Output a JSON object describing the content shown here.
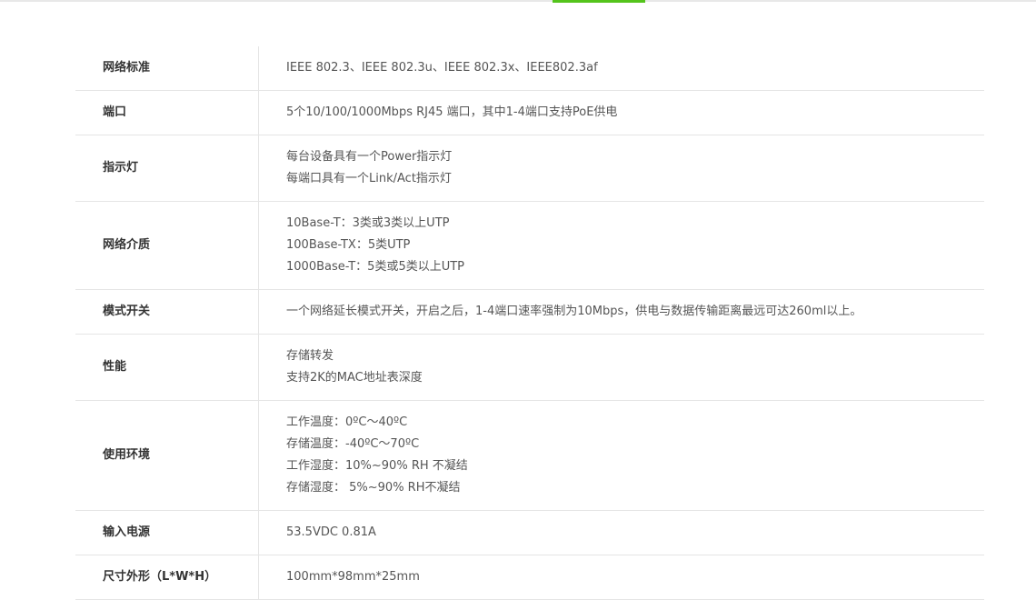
{
  "specs": [
    {
      "label": "网络标准",
      "lines": [
        "IEEE 802.3、IEEE 802.3u、IEEE 802.3x、IEEE802.3af"
      ]
    },
    {
      "label": "端口",
      "lines": [
        "5个10/100/1000Mbps RJ45 端口，其中1-4端口支持PoE供电"
      ]
    },
    {
      "label": "指示灯",
      "lines": [
        "每台设备具有一个Power指示灯",
        "每端口具有一个Link/Act指示灯"
      ]
    },
    {
      "label": "网络介质",
      "lines": [
        "10Base-T：3类或3类以上UTP",
        "100Base-TX：5类UTP",
        "1000Base-T：5类或5类以上UTP"
      ]
    },
    {
      "label": "模式开关",
      "lines": [
        "一个网络延长模式开关，开启之后，1-4端口速率强制为10Mbps，供电与数据传输距离最远可达260ml以上。"
      ]
    },
    {
      "label": "性能",
      "lines": [
        "存储转发",
        "支持2K的MAC地址表深度"
      ]
    },
    {
      "label": "使用环境",
      "lines": [
        "工作温度：0ºC～40ºC",
        "存储温度：-40ºC～70ºC",
        "工作湿度：10%~90% RH 不凝结",
        "存储湿度： 5%~90% RH不凝结"
      ]
    },
    {
      "label": "输入电源",
      "lines": [
        "53.5VDC 0.81A"
      ]
    },
    {
      "label": "尺寸外形（L*W*H）",
      "lines": [
        "100mm*98mm*25mm"
      ]
    }
  ],
  "colors": {
    "accent": "#54c41c",
    "border": "#e5e5e5"
  }
}
